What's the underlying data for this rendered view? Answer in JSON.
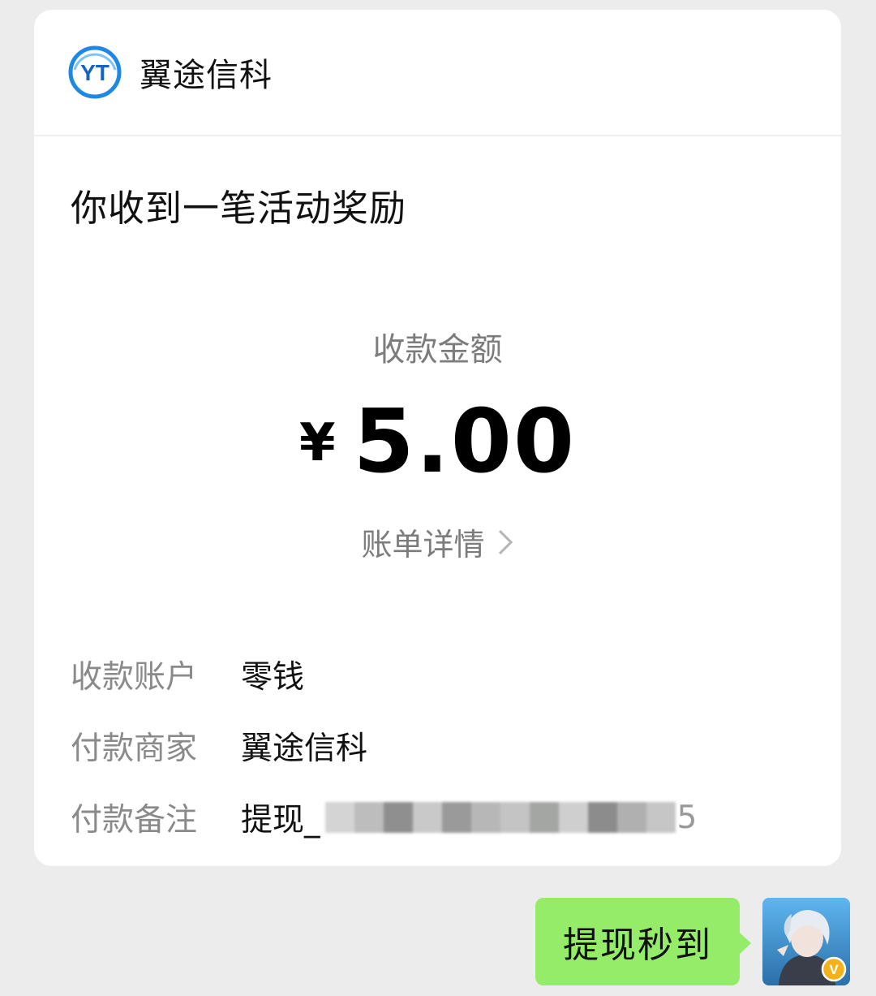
{
  "card": {
    "merchant_name": "翼途信科",
    "logo_text": "YT",
    "notice_title": "你收到一笔活动奖励",
    "amount_label": "收款金额",
    "currency_symbol": "¥",
    "amount_value": "5.00",
    "detail_link_label": "账单详情",
    "rows": [
      {
        "label": "收款账户",
        "value": "零钱"
      },
      {
        "label": "付款商家",
        "value": "翼途信科"
      },
      {
        "label": "付款备注",
        "value": "提现_",
        "tail": "5"
      }
    ]
  },
  "chat": {
    "bubble_text": "提现秒到",
    "avatar_badge": "V"
  },
  "colors": {
    "background": "#ececec",
    "card": "#ffffff",
    "bubble": "#95ec69",
    "logo_blue": "#1e88e5",
    "muted_text": "#7c7c7c",
    "badge": "#f3b21c"
  }
}
